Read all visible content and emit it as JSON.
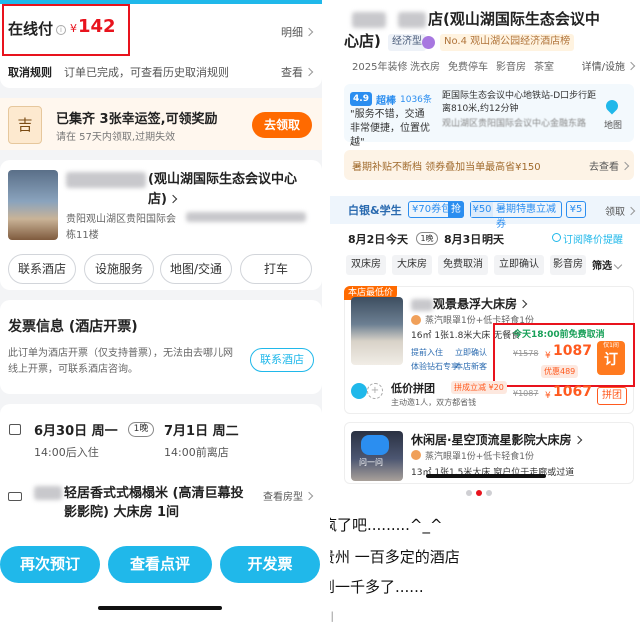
{
  "left": {
    "payment": {
      "label": "在线付",
      "currency": "¥",
      "amount": "142",
      "detail_link": "明细"
    },
    "cancel": {
      "label": "取消规则",
      "text": "订单已完成，可查看历史取消规则",
      "link": "查看"
    },
    "promo": {
      "badge": "吉",
      "title": "已集齐 3张幸运签,可领奖励",
      "subtitle": "请在 57天内领取,过期失效",
      "button": "去领取"
    },
    "hotel": {
      "name_suffix": "(观山湖国际生态会议中心店)",
      "address": "贵阳观山湖区贵阳国际会",
      "address_tail": "栋11楼",
      "buttons": [
        "联系酒店",
        "设施服务",
        "地图/交通",
        "打车"
      ]
    },
    "invoice": {
      "title": "发票信息 (酒店开票)",
      "text": "此订单为酒店开票（仅支持普票），无法由去哪儿网线上开票，可联系酒店咨询。",
      "button": "联系酒店"
    },
    "stay": {
      "checkin_date": "6月30日 周一",
      "nights": "1晚",
      "checkout_date": "7月1日 周二",
      "checkin_time": "14:00后入住",
      "checkout_time": "14:00前离店"
    },
    "room": {
      "name": "轻居香式式榻榻米 (高清巨幕投影影院) 大床房 1间",
      "link": "查看房型"
    },
    "actions": [
      "再次预订",
      "查看点评",
      "开发票"
    ]
  },
  "right": {
    "hotel": {
      "title_suffix": "店(观山湖国际生态会议中",
      "title_line2": "心店)",
      "tag_type": "经济型",
      "rank": "No.4 观山湖公园经济酒店榜"
    },
    "features": [
      "2025年装修",
      "洗衣房",
      "免费停车",
      "影音房",
      "茶室"
    ],
    "details_link": "详情/设施",
    "review": {
      "score": "4.9",
      "level": "超棒",
      "count": "1036条",
      "quote": "\"服务不错，交通非常便捷，位置优越\"",
      "location": "距国际生态会议中心地铁站-D口步行距离810米,约12分钟",
      "location_sub": "观山湖区贵阳国际会议中心金融东路",
      "map_label": "地图"
    },
    "subsidy": {
      "text": "暑期补贴不断档 领券叠加当单最高省¥150",
      "link": "去查看"
    },
    "coupons": {
      "tier": "白银&学生",
      "c1": "¥70券包",
      "c1_btn": "抢",
      "c2": "¥50",
      "c2_text": "暑期特惠立减券",
      "c3": "¥5",
      "collect": "领取"
    },
    "dates": {
      "checkin": "8月2日",
      "checkin_day": "今天",
      "nights": "1晚",
      "checkout": "8月3日",
      "checkout_day": "明天",
      "notice": "订阅降价提醒"
    },
    "filters": [
      "双床房",
      "大床房",
      "免费取消",
      "立即确认",
      "影音房",
      "筛选"
    ],
    "room1": {
      "label": "本店最低价",
      "name": "观景悬浮大床房",
      "breakfast": "蒸汽眼罩1份+低卡轻食1份",
      "specs": "16㎡ 1张1.8米大床 无餐食",
      "perks": [
        "提前入住",
        "立即确认",
        "体验钻石专享",
        "本店新客"
      ],
      "cancel_note": "今天18:00前免费取消",
      "old_price": "¥1578",
      "price_prefix": "¥",
      "price": "1087",
      "discount": "优惠489",
      "book": "订",
      "book_tag": "仅1间"
    },
    "room1_group": {
      "title": "低价拼团",
      "badge": "拼成立减 ¥20",
      "sub": "主动邀1人，双方都省钱",
      "old_price": "¥1087",
      "price_prefix": "¥",
      "price": "1067",
      "button": "拼团"
    },
    "room2": {
      "name": "休闲居·星空顶流星影院大床房",
      "breakfast": "蒸汽眼罩1份+低卡轻食1份",
      "specs": "13㎡ 1张1.5米大床 窗户位于走廊或过道",
      "assistant": "问一问"
    },
    "caption": {
      "line1": "疯了吧.........^_^",
      "line2": "贵州 一百多定的酒店",
      "line3": "到一千多了......",
      "line4": "川"
    }
  },
  "colors": {
    "blue": "#20b8ea",
    "orange": "#ff6a00",
    "red": "#e8131d",
    "price": "#ff5a1f"
  }
}
